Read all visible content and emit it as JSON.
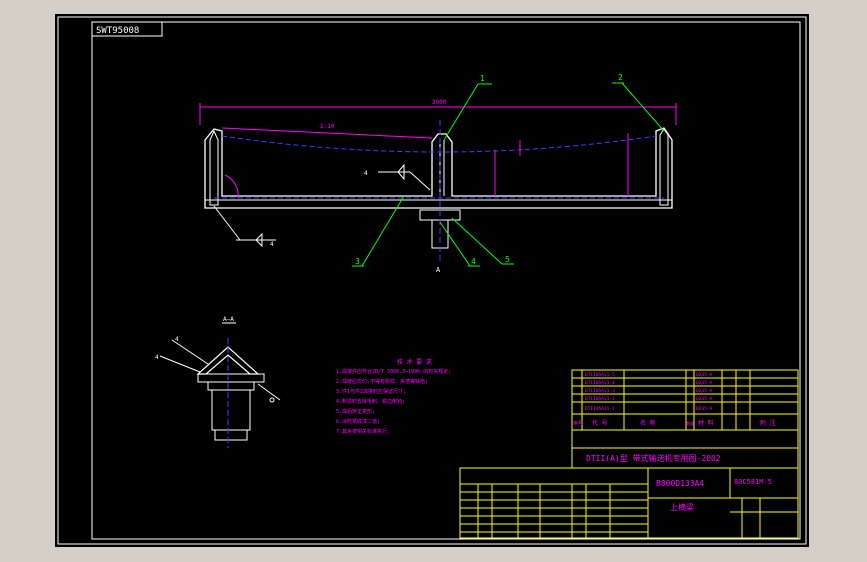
{
  "window": {
    "background": "#d4d0c8",
    "canvas_color": "#000000"
  },
  "colors": {
    "frame": "#ffffff",
    "part": "#ffffff",
    "dim": "#ff00ff",
    "leader": "#00ff00",
    "centerline": "#4040ff",
    "table": "#ffff00",
    "text": "#ff00ff"
  },
  "title_tag": "SWT95008",
  "dimensions": {
    "overall_width": "2000",
    "slope": "1:10"
  },
  "balloons": [
    "1",
    "2",
    "3",
    "4",
    "5"
  ],
  "section_mark": "A",
  "section_label": "A—A",
  "weld_symbols": [
    "4",
    "4",
    "4",
    "4"
  ],
  "notes_title": "技 术 要 求",
  "notes": [
    "1.焊接件应符合JB/T 5000.3—1998 的有关规定;",
    "2.焊缝应均匀,不得有裂纹、夹渣等缺陷;",
    "3.件1与件2焊接时应保证尺寸;",
    "4.制造时去除毛刺、锐边倒钝;",
    "5.焊后矫正变形;",
    "6.涂防锈底漆二道;",
    "7.其余按相关标准执行。"
  ],
  "bom_header": [
    "序号",
    "代 号",
    "名 称",
    "数量",
    "材 料",
    "单件",
    "总计",
    "附 注"
  ],
  "bom_rows": [
    [
      "5",
      "DTII05A31-5",
      "",
      "1",
      "Q235-A",
      "",
      "",
      ""
    ],
    [
      "4",
      "DTII05A31-4",
      "",
      "1",
      "Q235-A",
      "",
      "",
      ""
    ],
    [
      "3",
      "DTII05A31-3",
      "",
      "1",
      "Q235-A",
      "",
      "",
      ""
    ],
    [
      "2",
      "DTII05A31-2",
      "",
      "2",
      "Q235-A",
      "",
      "",
      ""
    ],
    [
      "1",
      "DTII05A31-1",
      "",
      "1",
      "Q235-A",
      "",
      "",
      ""
    ]
  ],
  "title_block": {
    "banner": "DTII(A)型 带式输送机专用图-2002",
    "drawing_no": "B800D133A4",
    "code": "80C581M-5",
    "part_name": "上横梁"
  }
}
